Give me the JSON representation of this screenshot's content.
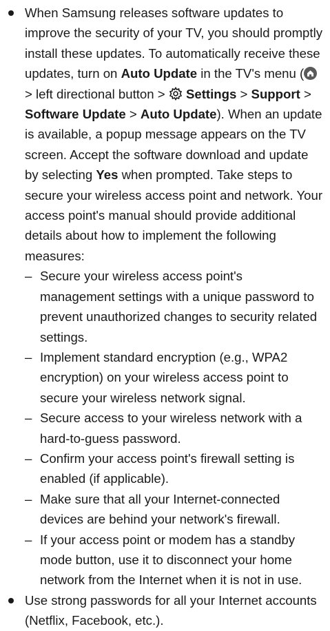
{
  "bullets": [
    {
      "p1": "When Samsung releases software updates to improve the security of your TV, you should promptly install these updates. To automatically receive these updates, turn on ",
      "auto_update": "Auto Update",
      "p2": " in the TV's menu (",
      "icon_home": "home-icon",
      "p3": " > left directional button > ",
      "icon_settings": "gear-icon",
      "settings": "Settings",
      "sep1": " > ",
      "support": "Support",
      "sep2": " > ",
      "software_update": "Software Update",
      "sep3": " > ",
      "auto_update_2": "Auto Update",
      "p4": "). When an update is available, a popup message appears on the TV screen. Accept the software download and update by selecting ",
      "yes": "Yes",
      "p5": " when prompted. Take steps to secure your wireless access point and network. Your access point's manual should provide additional details about how to implement the following measures:",
      "sub_items": [
        "Secure your wireless access point's management settings with a unique password to prevent unauthorized changes to security related settings.",
        "Implement standard encryption (e.g., WPA2 encryption) on your wireless access point to secure your wireless network signal.",
        "Secure access to your wireless network with a hard-to-guess password.",
        "Confirm your access point's firewall setting is enabled (if applicable).",
        "Make sure that all your Internet-connected devices are behind your network's firewall.",
        "If your access point or modem has a standby mode button, use it to disconnect your home network from the Internet when it is not in use."
      ]
    },
    {
      "text": "Use strong passwords for all your Internet accounts (Netflix, Facebook, etc.)."
    }
  ],
  "dash_char": "–"
}
